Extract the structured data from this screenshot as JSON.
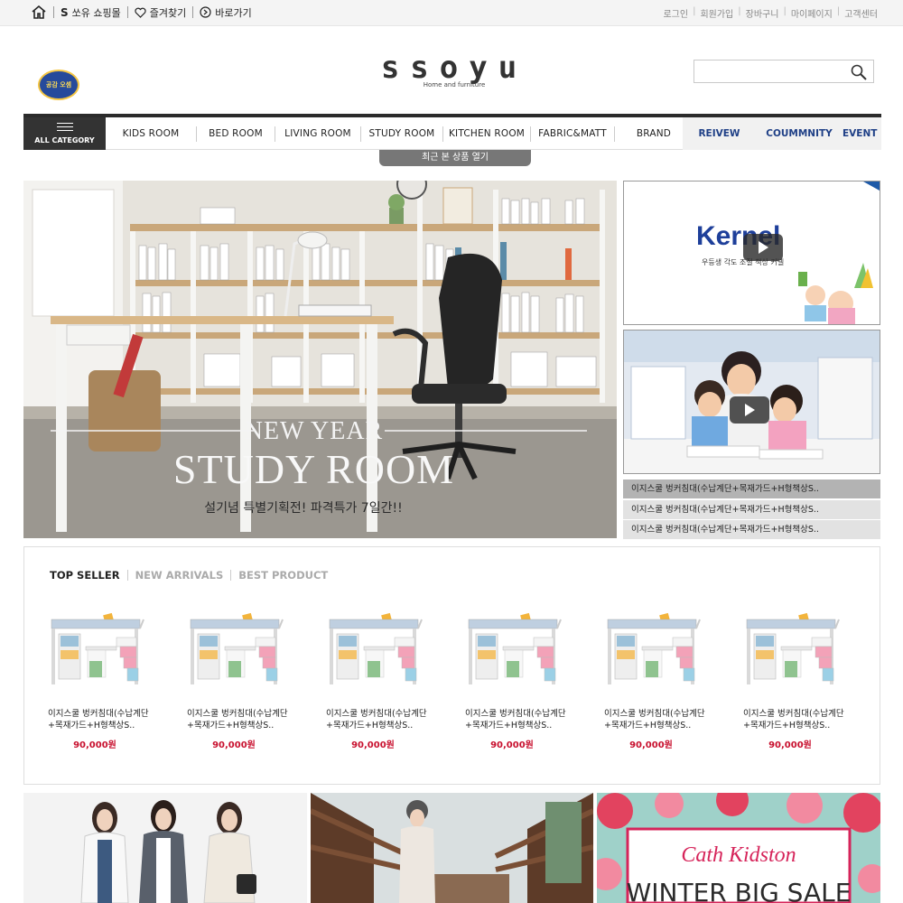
{
  "topbar": {
    "home_label": "",
    "shop_label": "쏘유 쇼핑몰",
    "favorites_label": "즐겨찾기",
    "shortcut_label": "바로가기",
    "links": [
      "로그인",
      "회원가입",
      "장바구니",
      "마이페이지",
      "고객센터"
    ]
  },
  "header": {
    "logo_text": "ssoyu",
    "logo_sub": "Home and furniture",
    "seal_text": "공감 오셈",
    "search_placeholder": ""
  },
  "nav": {
    "all_category": "ALL CATEGORY",
    "menu": [
      "KIDS ROOM",
      "BED ROOM",
      "LIVING ROOM",
      "STUDY ROOM",
      "KITCHEN ROOM",
      "FABRIC&MATT",
      "BRAND"
    ],
    "extra": [
      "REIVEW",
      "COUMMNITY",
      "EVENT"
    ],
    "recent_label": "최근 본 상품 열기"
  },
  "hero": {
    "line1": "NEW YEAR",
    "line2": "STUDY ROOM",
    "line3": "설기념 특별기획전! 파격특가 7일간!!"
  },
  "video": {
    "brand": "Kernel",
    "tagline": "우등생 각도 조절 책상 커넬"
  },
  "video_list": [
    "이지스쿨 벙커침대(수납계단+목재가드+H형책상S..",
    "이지스쿨 벙커침대(수납계단+목재가드+H형책상S..",
    "이지스쿨 벙커침대(수납계단+목재가드+H형책상S.."
  ],
  "products": {
    "tabs": [
      "TOP SELLER",
      "NEW ARRIVALS",
      "BEST PRODUCT"
    ],
    "items": [
      {
        "name": "이지스쿨 벙커침대(수납계단+목재가드+H형책상S..",
        "price": "90,000원"
      },
      {
        "name": "이지스쿨 벙커침대(수납계단+목재가드+H형책상S..",
        "price": "90,000원"
      },
      {
        "name": "이지스쿨 벙커침대(수납계단+목재가드+H형책상S..",
        "price": "90,000원"
      },
      {
        "name": "이지스쿨 벙커침대(수납계단+목재가드+H형책상S..",
        "price": "90,000원"
      },
      {
        "name": "이지스쿨 벙커침대(수납계단+목재가드+H형책상S..",
        "price": "90,000원"
      },
      {
        "name": "이지스쿨 벙커침대(수납계단+목재가드+H형책상S..",
        "price": "90,000원"
      }
    ]
  },
  "banners": {
    "brand": "Cath Kidston",
    "sale": "WINTER BIG SALE"
  }
}
